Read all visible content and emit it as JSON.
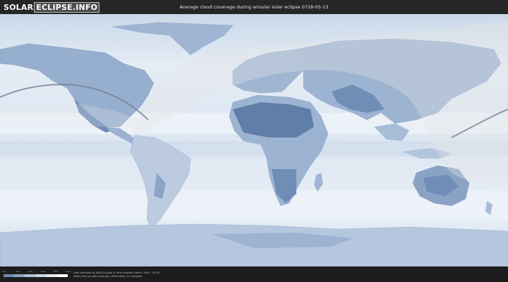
{
  "header": {
    "logo_left": "SOLAR",
    "logo_right": "ECLIPSE.INFO",
    "title": "Average cloud coverage during annular solar eclipse 0728-05-13"
  },
  "legend": {
    "ticks": [
      "0%",
      "20%",
      "40%",
      "60%",
      "80%",
      "100%"
    ],
    "colors": [
      "#6f8db5",
      "#8ea7c7",
      "#adc0d8",
      "#cbd7e6",
      "#e5ecf4",
      "#ffffff"
    ]
  },
  "footer": {
    "credit_line1": "Data provided by NASA's Aqua & Terra satellite (Years: 2000 - 2019)",
    "credit_line2": "https://neo.sci.gsfc.nasa.gov | Resolution: 0.1 degrees"
  },
  "colors": {
    "ocean": "#dfe8f2",
    "land_cloudy": "#8aa3c5",
    "land_clear": "#5f7ea8",
    "path_line": "#6e7e92",
    "visibility_overlay": "#e6e6e6"
  }
}
